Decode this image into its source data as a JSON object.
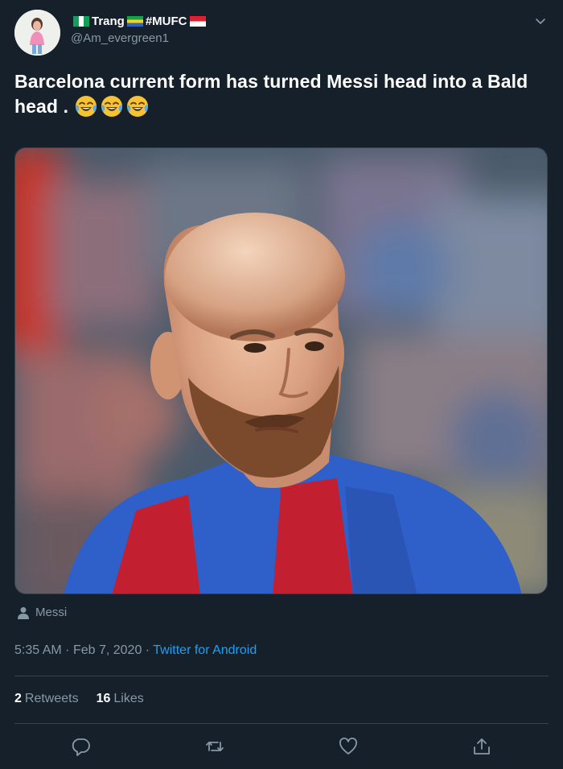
{
  "user": {
    "display_name_part1": "Trang",
    "display_name_part2": "#MUFC",
    "handle": "@Am_evergreen1"
  },
  "tweet": {
    "text": "Barcelona current form has turned Messi head into a  Bald head . ",
    "emoji_count": 3,
    "emoji_icon": "face-with-tears-of-joy-icon"
  },
  "media": {
    "tagged_person": "Messi"
  },
  "meta": {
    "time": "5:35 AM",
    "separator": "·",
    "date": "Feb 7, 2020",
    "source": "Twitter for Android"
  },
  "stats": {
    "retweets_count": "2",
    "retweets_label": "Retweets",
    "likes_count": "16",
    "likes_label": "Likes"
  },
  "colors": {
    "background": "#15202b",
    "text_primary": "#ffffff",
    "text_secondary": "#8899a6",
    "link": "#1da1f2",
    "divider": "#38444d"
  }
}
